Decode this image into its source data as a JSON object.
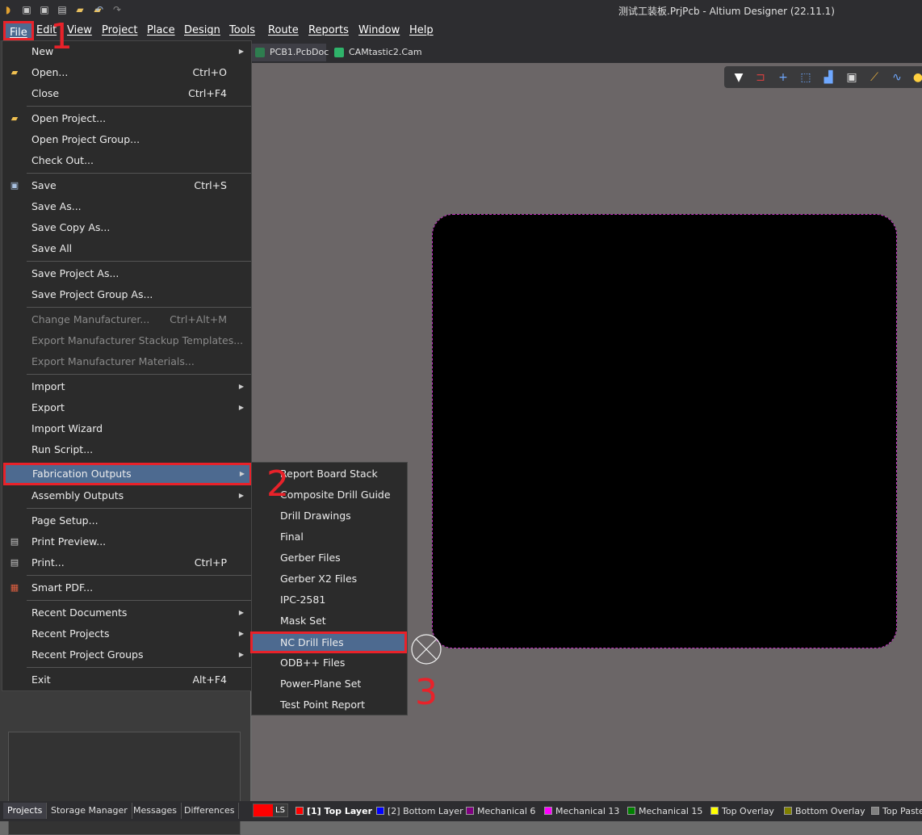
{
  "window": {
    "title": "测试工装板.PrjPcb - Altium Designer (22.11.1)"
  },
  "titlebar_icons": [
    "app-logo-icon",
    "save-icon",
    "save-all-icon",
    "print-icon",
    "open-folder-icon",
    "open-project-icon",
    "undo-icon",
    "redo-icon"
  ],
  "menubar": {
    "file": "File",
    "edit": "Edit",
    "view": "View",
    "project": "Project",
    "place": "Place",
    "design": "Design",
    "tools": "Tools",
    "route": "Route",
    "reports": "Reports",
    "window": "Window",
    "help": "Help"
  },
  "tabs": [
    {
      "label": "PCB1.PcbDoc",
      "active": true,
      "icon_color": "#2e7d4f"
    },
    {
      "label": "CAMtastic2.Cam *",
      "active": false,
      "icon_color": "#2fb36a"
    }
  ],
  "file_menu": [
    {
      "label": "New",
      "shortcut": "",
      "submenu": true,
      "disabled": false
    },
    {
      "label": "Open...",
      "shortcut": "Ctrl+O",
      "submenu": false,
      "disabled": false,
      "icon": "open-folder-icon"
    },
    {
      "label": "Close",
      "shortcut": "Ctrl+F4",
      "submenu": false,
      "disabled": false
    },
    {
      "label": "Open Project...",
      "shortcut": "",
      "submenu": false,
      "disabled": false,
      "icon": "open-project-icon"
    },
    {
      "label": "Open Project Group...",
      "shortcut": "",
      "submenu": false,
      "disabled": false
    },
    {
      "label": "Check Out...",
      "shortcut": "",
      "submenu": false,
      "disabled": false
    },
    {
      "label": "Save",
      "shortcut": "Ctrl+S",
      "submenu": false,
      "disabled": false,
      "icon": "save-icon"
    },
    {
      "label": "Save As...",
      "shortcut": "",
      "submenu": false,
      "disabled": false
    },
    {
      "label": "Save Copy As...",
      "shortcut": "",
      "submenu": false,
      "disabled": false
    },
    {
      "label": "Save All",
      "shortcut": "",
      "submenu": false,
      "disabled": false
    },
    {
      "label": "Save Project As...",
      "shortcut": "",
      "submenu": false,
      "disabled": false
    },
    {
      "label": "Save Project Group As...",
      "shortcut": "",
      "submenu": false,
      "disabled": false
    },
    {
      "label": "Change Manufacturer...",
      "shortcut": "Ctrl+Alt+M",
      "submenu": false,
      "disabled": true
    },
    {
      "label": "Export Manufacturer Stackup Templates...",
      "shortcut": "",
      "submenu": false,
      "disabled": true
    },
    {
      "label": "Export Manufacturer Materials...",
      "shortcut": "",
      "submenu": false,
      "disabled": true
    },
    {
      "label": "Import",
      "shortcut": "",
      "submenu": true,
      "disabled": false
    },
    {
      "label": "Export",
      "shortcut": "",
      "submenu": true,
      "disabled": false
    },
    {
      "label": "Import Wizard",
      "shortcut": "",
      "submenu": false,
      "disabled": false
    },
    {
      "label": "Run Script...",
      "shortcut": "",
      "submenu": false,
      "disabled": false
    },
    {
      "label": "Fabrication Outputs",
      "shortcut": "",
      "submenu": true,
      "disabled": false,
      "highlighted": true
    },
    {
      "label": "Assembly Outputs",
      "shortcut": "",
      "submenu": true,
      "disabled": false
    },
    {
      "label": "Page Setup...",
      "shortcut": "",
      "submenu": false,
      "disabled": false
    },
    {
      "label": "Print Preview...",
      "shortcut": "",
      "submenu": false,
      "disabled": false,
      "icon": "print-preview-icon"
    },
    {
      "label": "Print...",
      "shortcut": "Ctrl+P",
      "submenu": false,
      "disabled": false,
      "icon": "print-icon"
    },
    {
      "label": "Smart PDF...",
      "shortcut": "",
      "submenu": false,
      "disabled": false,
      "icon": "smart-pdf-icon"
    },
    {
      "label": "Recent Documents",
      "shortcut": "",
      "submenu": true,
      "disabled": false
    },
    {
      "label": "Recent Projects",
      "shortcut": "",
      "submenu": true,
      "disabled": false
    },
    {
      "label": "Recent Project Groups",
      "shortcut": "",
      "submenu": true,
      "disabled": false
    },
    {
      "label": "Exit",
      "shortcut": "Alt+F4",
      "submenu": false,
      "disabled": false
    }
  ],
  "fabrication_submenu": [
    {
      "label": "Report Board Stack"
    },
    {
      "label": "Composite Drill Guide"
    },
    {
      "label": "Drill Drawings"
    },
    {
      "label": "Final"
    },
    {
      "label": "Gerber Files"
    },
    {
      "label": "Gerber X2 Files"
    },
    {
      "label": "IPC-2581"
    },
    {
      "label": "Mask Set"
    },
    {
      "label": "NC Drill Files",
      "highlighted": true
    },
    {
      "label": "ODB++ Files"
    },
    {
      "label": "Power-Plane Set"
    },
    {
      "label": "Test Point Report"
    }
  ],
  "annotations": {
    "step1": "1",
    "step2": "2",
    "step3": "3",
    "color": "#e8222a"
  },
  "panel_tabs": [
    "Projects",
    "Storage Manager",
    "Messages",
    "Differences"
  ],
  "layers": {
    "ls_label": "LS",
    "items": [
      {
        "name": "[1] Top Layer",
        "color": "#ff0000",
        "active": true
      },
      {
        "name": "[2] Bottom Layer",
        "color": "#0000ff"
      },
      {
        "name": "Mechanical 6",
        "color": "#800080"
      },
      {
        "name": "Mechanical 13",
        "color": "#ff00ff"
      },
      {
        "name": "Mechanical 15",
        "color": "#008000"
      },
      {
        "name": "Top Overlay",
        "color": "#ffff00"
      },
      {
        "name": "Bottom Overlay",
        "color": "#808000"
      },
      {
        "name": "Top Paste",
        "color": "#808080"
      }
    ]
  },
  "toolbar_icons": [
    "filter-icon",
    "route-icon",
    "crosshair-icon",
    "select-rect-icon",
    "chart-icon",
    "component-icon",
    "interactive-route-icon",
    "wave-route-icon",
    "bulb-icon"
  ]
}
